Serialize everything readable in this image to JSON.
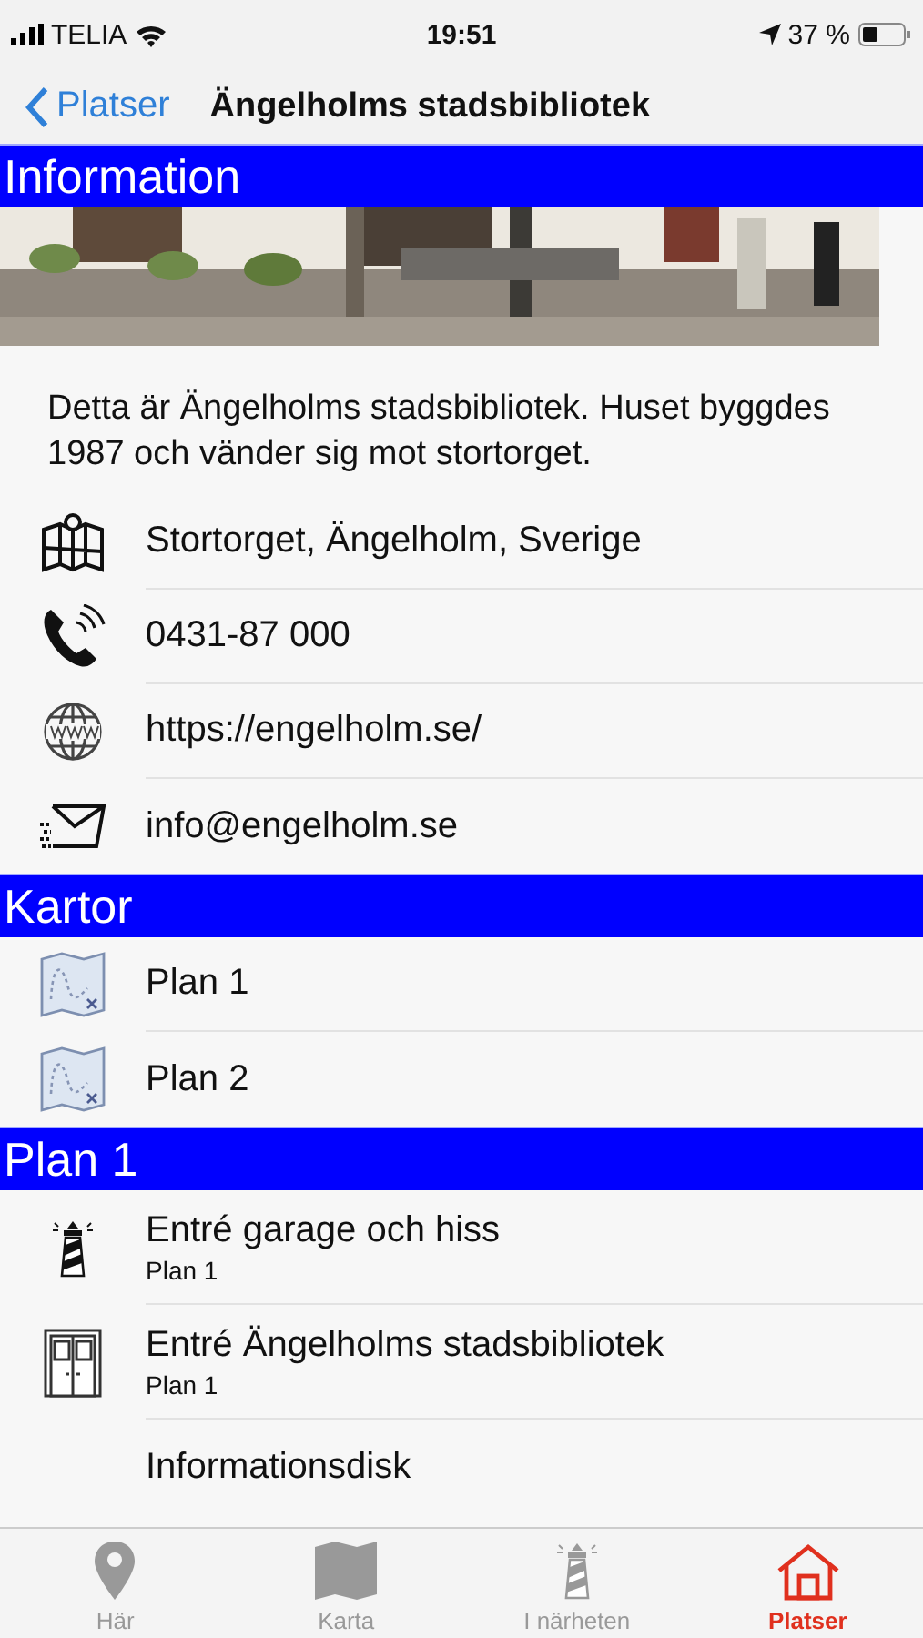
{
  "status_bar": {
    "carrier": "TELIA",
    "time": "19:51",
    "battery": "37 %"
  },
  "nav": {
    "back": "Platser",
    "title": "Ängelholms stadsbibliotek"
  },
  "sections": [
    {
      "title": "Information",
      "description": "Detta är Ängelholms stadsbibliotek. Huset byggdes 1987 och vänder sig mot stortorget.",
      "rows": [
        {
          "kind": "map",
          "title": "Stortorget, Ängelholm, Sverige"
        },
        {
          "kind": "phone",
          "title": "0431-87 000"
        },
        {
          "kind": "globe",
          "title": "https://engelholm.se/"
        },
        {
          "kind": "mail",
          "title": "info@engelholm.se"
        }
      ]
    },
    {
      "title": "Kartor",
      "rows": [
        {
          "kind": "plan",
          "title": "Plan 1"
        },
        {
          "kind": "plan",
          "title": "Plan 2"
        }
      ]
    },
    {
      "title": "Plan 1",
      "rows": [
        {
          "kind": "lighthouse",
          "title": "Entré garage och hiss",
          "subtitle": "Plan 1"
        },
        {
          "kind": "door",
          "title": "Entré Ängelholms stadsbibliotek",
          "subtitle": "Plan 1"
        },
        {
          "title": "Informationsdisk"
        }
      ]
    }
  ],
  "tabs": [
    {
      "kind": "pin",
      "label": "Här",
      "selected": false
    },
    {
      "kind": "map",
      "label": "Karta",
      "selected": false
    },
    {
      "kind": "lighthouse",
      "label": "I närheten",
      "selected": false
    },
    {
      "kind": "house",
      "label": "Platser",
      "selected": true
    }
  ]
}
